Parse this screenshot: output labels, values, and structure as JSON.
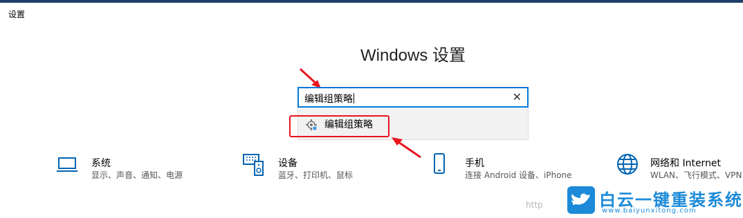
{
  "window": {
    "title": "设置"
  },
  "header": {
    "heading": "Windows 设置"
  },
  "search": {
    "value": "编辑组策略",
    "clear_icon": "close-icon"
  },
  "dropdown": {
    "items": [
      {
        "label": "编辑组策略",
        "icon": "group-policy-icon"
      }
    ]
  },
  "categories": [
    {
      "title": "系统",
      "desc": "显示、声音、通知、电源",
      "icon": "laptop-icon"
    },
    {
      "title": "设备",
      "desc": "蓝牙、打印机、鼠标",
      "icon": "devices-icon"
    },
    {
      "title": "手机",
      "desc": "连接 Android 设备、iPhone",
      "icon": "phone-icon"
    },
    {
      "title": "网络和 Internet",
      "desc": "WLAN、飞行模式、VPN",
      "icon": "globe-icon"
    }
  ],
  "watermark": {
    "text": "http",
    "logo_text": "白云一键重装系统",
    "logo_url": "www.baiyunxitong.com"
  },
  "colors": {
    "accent": "#0078d7",
    "annotation": "#e8141e",
    "icon_blue": "#0063b1",
    "logo_blue": "#1c8ad8"
  }
}
